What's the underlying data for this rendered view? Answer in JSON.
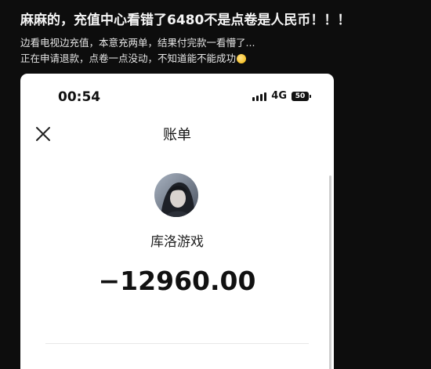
{
  "post": {
    "title": "麻麻的，充值中心看错了6480不是点卷是人民币！！！",
    "body_line1": "边看电视边充值，本意充两单，结果付完款一看懵了...",
    "body_line2": "正在申请退款，点卷一点没动，不知道能不能成功",
    "emoji_icon": "face-emoji-icon"
  },
  "phone": {
    "status_time": "00:54",
    "network": "4G",
    "battery": "50",
    "page_title": "账单",
    "merchant_name": "库洛游戏",
    "amount": "−12960.00"
  }
}
